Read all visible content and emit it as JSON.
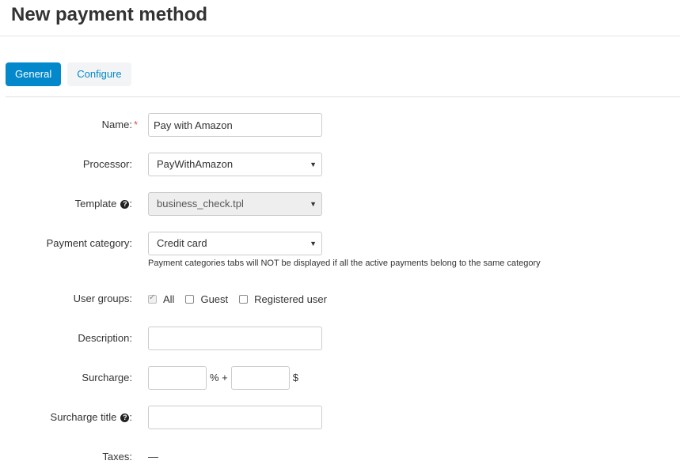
{
  "page": {
    "title": "New payment method"
  },
  "tabs": [
    {
      "label": "General",
      "active": true
    },
    {
      "label": "Configure",
      "active": false
    }
  ],
  "form": {
    "name": {
      "label": "Name:",
      "required_mark": "*",
      "value": "Pay with Amazon"
    },
    "processor": {
      "label": "Processor:",
      "value": "PayWithAmazon"
    },
    "template": {
      "label": "Template",
      "colon": ":",
      "value": "business_check.tpl",
      "help_icon": "question-circle-icon"
    },
    "payment_category": {
      "label": "Payment category:",
      "value": "Credit card",
      "hint": "Payment categories tabs will NOT be displayed if all the active payments belong to the same category"
    },
    "user_groups": {
      "label": "User groups:",
      "options": [
        {
          "label": "All",
          "checked": true
        },
        {
          "label": "Guest",
          "checked": false
        },
        {
          "label": "Registered user",
          "checked": false
        }
      ]
    },
    "description": {
      "label": "Description:",
      "value": ""
    },
    "surcharge": {
      "label": "Surcharge:",
      "percent_sep": "% +",
      "currency": "$",
      "percent_value": "",
      "fixed_value": ""
    },
    "surcharge_title": {
      "label": "Surcharge title",
      "colon": ":",
      "value": "",
      "help_icon": "question-circle-icon"
    },
    "taxes": {
      "label": "Taxes:",
      "value": "—"
    }
  },
  "colors": {
    "accent": "#0388cc",
    "required": "#d9534f"
  }
}
